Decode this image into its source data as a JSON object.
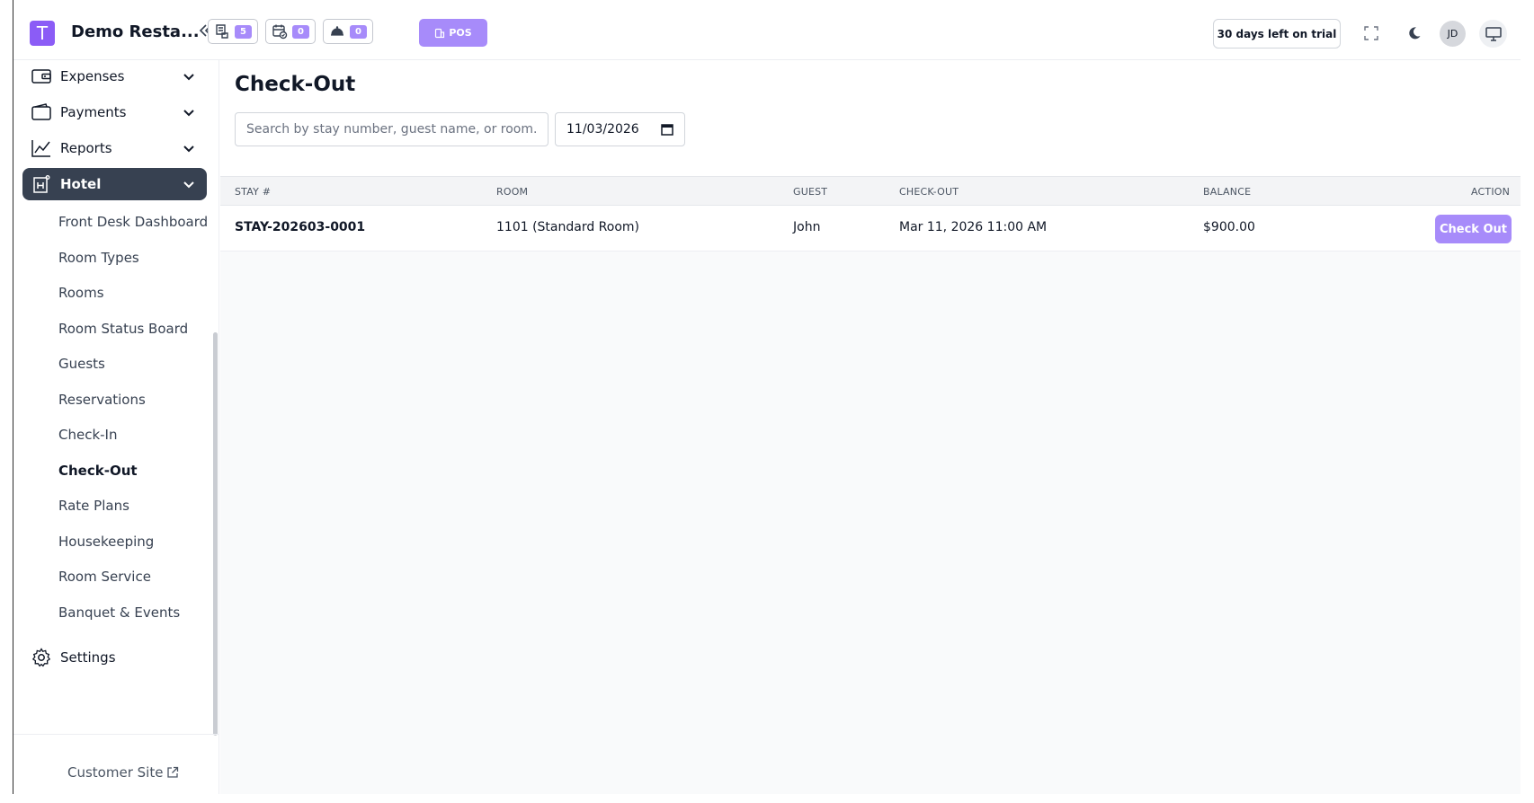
{
  "header": {
    "logo_letter": "T",
    "brand": "Demo Resta...",
    "badges": [
      {
        "icon": "receipt-icon",
        "count": "5"
      },
      {
        "icon": "calendar-check-icon",
        "count": "0"
      },
      {
        "icon": "cloche-icon",
        "count": "0"
      }
    ],
    "pos_label": "POS",
    "trial_text": "30 days left on trial",
    "avatar_initials": "JD"
  },
  "sidebar": {
    "items": [
      {
        "label": "Expenses",
        "icon": "wallet-icon"
      },
      {
        "label": "Payments",
        "icon": "cash-wallet-icon"
      },
      {
        "label": "Reports",
        "icon": "chart-line-icon"
      },
      {
        "label": "Hotel",
        "icon": "hotel-icon"
      }
    ],
    "hotel_subitems": [
      "Front Desk Dashboard",
      "Room Types",
      "Rooms",
      "Room Status Board",
      "Guests",
      "Reservations",
      "Check-In",
      "Check-Out",
      "Rate Plans",
      "Housekeeping",
      "Room Service",
      "Banquet & Events"
    ],
    "current_subitem": "Check-Out",
    "settings_label": "Settings",
    "customer_site_label": "Customer Site"
  },
  "main": {
    "title": "Check-Out",
    "search_placeholder": "Search by stay number, guest name, or room...",
    "date_value": "11/03/2026",
    "columns": [
      "STAY #",
      "ROOM",
      "GUEST",
      "CHECK-OUT",
      "BALANCE",
      "ACTION"
    ],
    "rows": [
      {
        "stay": "STAY-202603-0001",
        "room": "1101 (Standard Room)",
        "guest": "John",
        "checkout": "Mar 11, 2026 11:00 AM",
        "balance": "$900.00",
        "action": "Check Out"
      }
    ]
  },
  "colors": {
    "accent": "#a78bfa",
    "logo": "#8b5cf6",
    "active_nav": "#374151"
  }
}
